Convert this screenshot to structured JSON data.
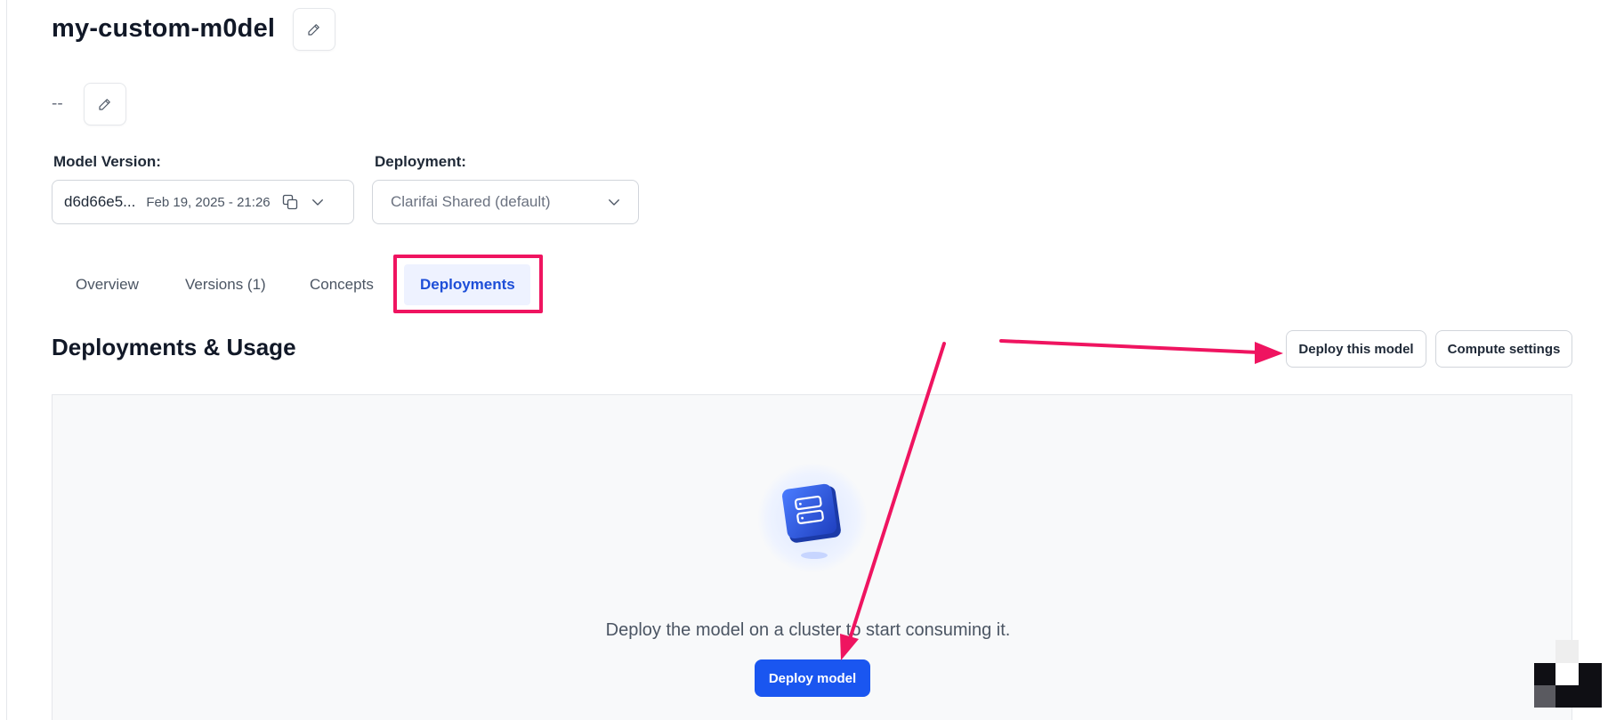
{
  "model": {
    "title": "my-custom-m0del",
    "description": "--"
  },
  "fields": {
    "model_version_label": "Model Version:",
    "model_version_id": "d6d66e5...",
    "model_version_date": "Feb 19, 2025 - 21:26",
    "deployment_label": "Deployment:",
    "deployment_value": "Clarifai Shared (default)"
  },
  "tabs": [
    {
      "label": "Overview"
    },
    {
      "label": "Versions (1)"
    },
    {
      "label": "Concepts"
    },
    {
      "label": "Deployments",
      "active": true
    }
  ],
  "section": {
    "title": "Deployments & Usage",
    "deploy_this_model": "Deploy this model",
    "compute_settings": "Compute settings"
  },
  "empty_state": {
    "message": "Deploy the model on a cluster to start consuming it.",
    "button": "Deploy model"
  },
  "colors": {
    "accent": "#1a56f0",
    "annotation": "#ef1460",
    "active_tab_bg": "#eef2ff"
  }
}
